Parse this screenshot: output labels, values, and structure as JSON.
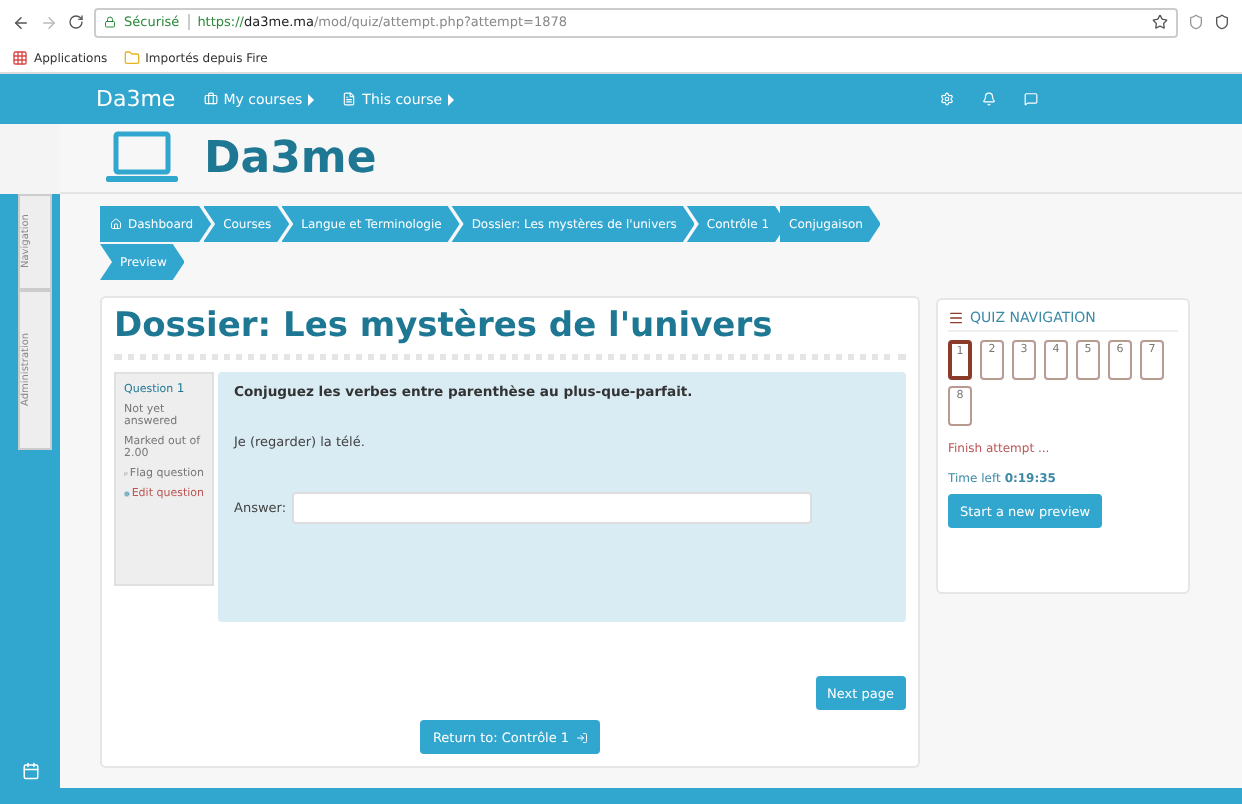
{
  "browser": {
    "security": "Sécurisé",
    "url": {
      "scheme": "https://",
      "host": "da3me.ma",
      "path": "/mod/quiz/attempt.php?attempt=1878"
    },
    "bookmarks": [
      {
        "kind": "apps",
        "label": "Applications"
      },
      {
        "kind": "folder",
        "label": "Importés depuis Fire"
      }
    ]
  },
  "navbar": {
    "brand": "Da3me",
    "menus": [
      "My courses",
      "This course"
    ]
  },
  "site": {
    "name": "Da3me"
  },
  "side_tabs": [
    "Navigation",
    "Administration"
  ],
  "breadcrumb": [
    {
      "label": "Dashboard",
      "kind": "home"
    },
    {
      "label": "Courses",
      "kind": "link"
    },
    {
      "label": "Langue et Terminologie",
      "kind": "link"
    },
    {
      "label": "Dossier: Les mystères de l'univers",
      "kind": "link"
    },
    {
      "label": "Contrôle 1",
      "kind": "link"
    },
    {
      "label": "Conjugaison",
      "kind": "link"
    },
    {
      "label": "Preview",
      "kind": "link"
    }
  ],
  "page_title": "Dossier: Les mystères de l'univers",
  "question": {
    "label": "Question",
    "number": "1",
    "status": "Not yet answered",
    "marks": "Marked out of 2.00",
    "flag": "Flag question",
    "edit": "Edit question",
    "prompt": "Conjuguez les verbes entre parenthèse au plus-que-parfait.",
    "sentence": "Je (regarder) la télé.",
    "answer_label": "Answer:"
  },
  "next_button": "Next page",
  "return_button": "Return to: Contrôle 1",
  "quiz_nav": {
    "title": "QUIZ NAVIGATION",
    "pages": [
      {
        "label": "1",
        "selected": true
      },
      {
        "label": "2",
        "selected": false
      },
      {
        "label": "3",
        "selected": false
      },
      {
        "label": "4",
        "selected": false
      },
      {
        "label": "5",
        "selected": false
      },
      {
        "label": "6",
        "selected": false
      },
      {
        "label": "7",
        "selected": false
      },
      {
        "label": "8",
        "selected": false
      }
    ],
    "finish": "Finish attempt ...",
    "time_label": "Time left",
    "time": "0:19:35",
    "new_preview": "Start a new preview"
  }
}
